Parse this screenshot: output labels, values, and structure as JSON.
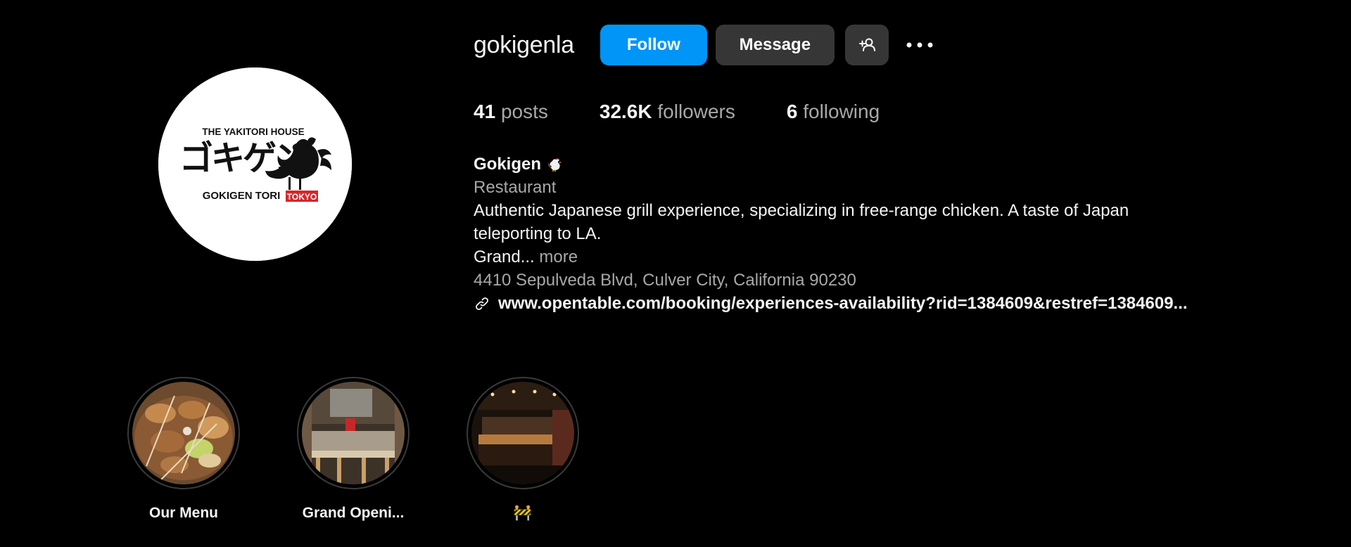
{
  "profile": {
    "username": "gokigenla",
    "avatar_logo": {
      "top_text": "THE YAKITORI HOUSE",
      "jp_text": "ゴキゲン",
      "bottom_text": "GOKIGEN TORI",
      "badge_text": "TOKYO",
      "badge_color": "#d7262b"
    }
  },
  "actions": {
    "follow_label": "Follow",
    "message_label": "Message",
    "add_user_icon": "add-user-icon",
    "more_icon": "more-options-icon"
  },
  "stats": {
    "posts": {
      "count": "41",
      "label": "posts"
    },
    "followers": {
      "count": "32.6K",
      "label": "followers"
    },
    "following": {
      "count": "6",
      "label": "following"
    }
  },
  "bio": {
    "name": "Gokigen",
    "name_icon": "rooster-icon",
    "category": "Restaurant",
    "text_line1": "Authentic Japanese grill experience, specializing in free-range chicken. A taste of Japan",
    "text_line2": "teleporting to LA.",
    "text_line3": "Grand...",
    "more_label": "more",
    "address": "4410 Sepulveda Blvd, Culver City, California 90230",
    "link_icon": "link-icon",
    "link_text": "www.opentable.com/booking/experiences-availability?rid=1384609&restref=1384609..."
  },
  "highlights": [
    {
      "label": "Our Menu",
      "image": "yakitori-skewers"
    },
    {
      "label": "Grand Openi...",
      "image": "restaurant-interior-counter"
    },
    {
      "label": "🚧",
      "image": "restaurant-bar-night"
    }
  ],
  "colors": {
    "background": "#000000",
    "follow_button": "#0095f6",
    "secondary_button": "#363636",
    "muted_text": "#a8a8a8",
    "primary_text": "#f5f5f5"
  }
}
